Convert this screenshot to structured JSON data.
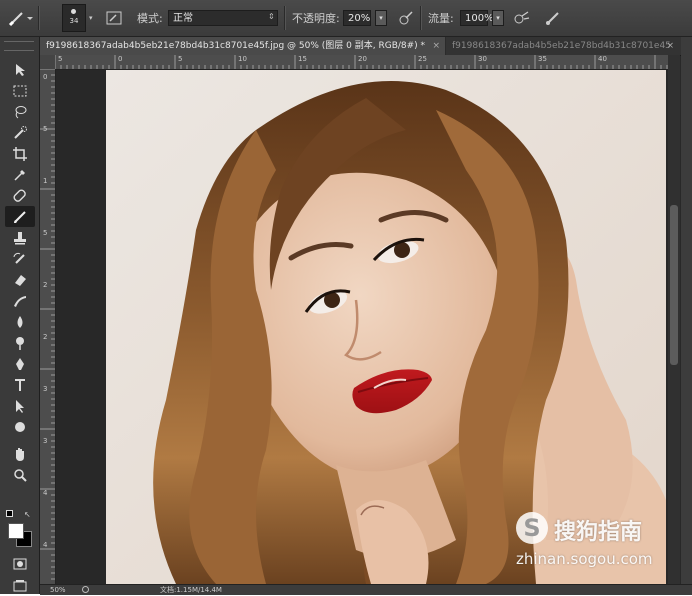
{
  "options_bar": {
    "brush_size": "34",
    "mode_label": "模式:",
    "mode_value": "正常",
    "opacity_label": "不透明度:",
    "opacity_value": "20%",
    "flow_label": "流量:",
    "flow_value": "100%"
  },
  "tabs": [
    {
      "title": "f9198618367adab4b5eb21e78bd4b31c8701e45f.jpg @ 50% (图层 0 副本, RGB/8#) *",
      "close": "×"
    },
    {
      "title": "f9198618367adab4b5eb21e78bd4b31c8701e45",
      "close": "×"
    }
  ],
  "ruler": {
    "h_labels": [
      "5",
      "0",
      "5",
      "10",
      "15",
      "20",
      "25",
      "30",
      "35",
      "40"
    ],
    "v_labels": [
      "0",
      "5",
      "1",
      "5",
      "2",
      "2",
      "3",
      "3",
      "4",
      "4"
    ]
  },
  "status_bar": {
    "zoom": "50%",
    "doc_info": "文档:1.15M/14.4M"
  },
  "watermark": {
    "mark": "S",
    "name": "搜狗指南",
    "url": "zhinan.sogou.com"
  },
  "tools": [
    "move-tool",
    "marquee-tool",
    "lasso-tool",
    "quick-select-tool",
    "crop-tool",
    "eyedropper-tool",
    "spot-heal-tool",
    "brush-tool",
    "clone-stamp-tool",
    "history-brush-tool",
    "eraser-tool",
    "gradient-tool",
    "blur-tool",
    "dodge-tool",
    "pen-tool",
    "type-tool",
    "path-select-tool",
    "shape-tool",
    "hand-tool",
    "zoom-tool"
  ],
  "colors": {
    "foreground": "#ffffff",
    "background": "#000000",
    "lips": "#c01a1e",
    "hair": "#7a4a24"
  }
}
